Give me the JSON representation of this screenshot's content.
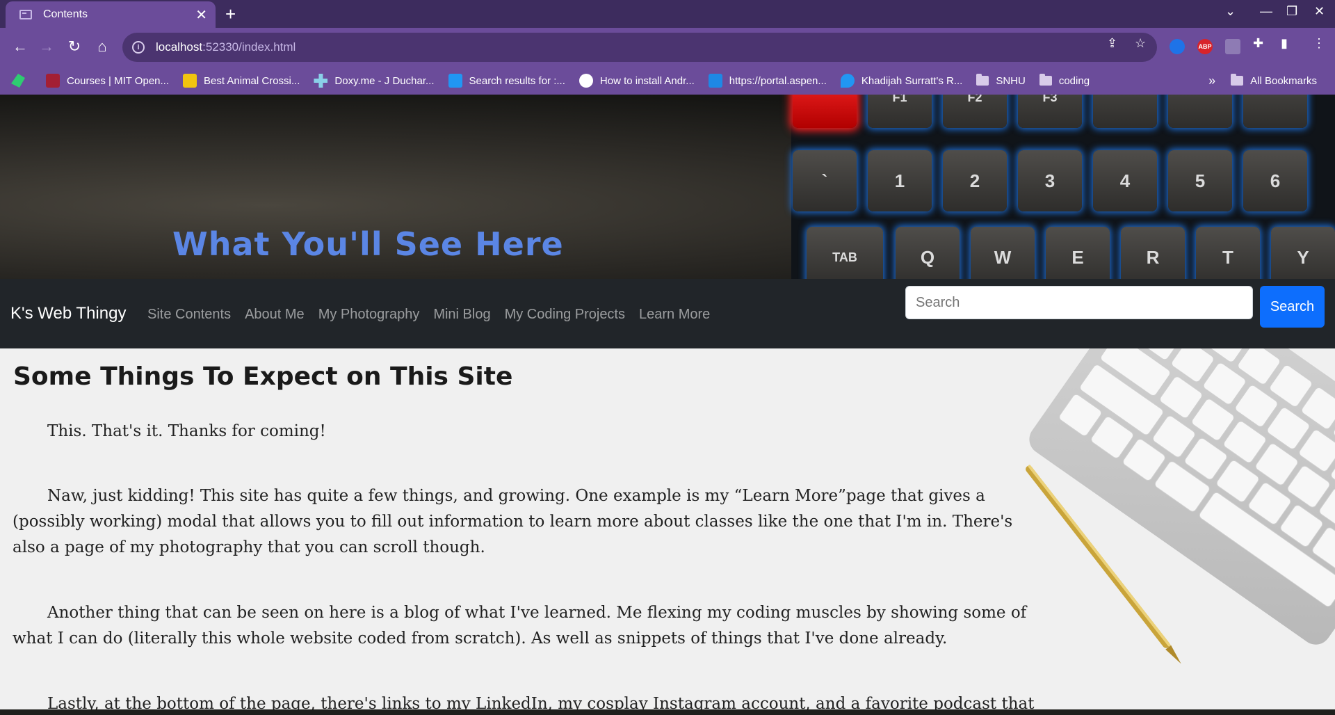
{
  "browser": {
    "tab_title": "Contents",
    "tab_close": "✕",
    "new_tab": "+",
    "url_host": "localhost",
    "url_path": ":52330/index.html",
    "back": "←",
    "forward": "→",
    "reload": "↻",
    "home": "⌂",
    "window_dropdown": "⌄",
    "minimize": "—",
    "maximize": "❐",
    "close": "✕",
    "share": "⇪",
    "star": "☆",
    "puzzle": "✚",
    "sidepanel": "▮",
    "menu": "⋮",
    "abp": "ABP"
  },
  "bookmarks": {
    "items": [
      {
        "label": "",
        "icon": "feather-icon",
        "color": "#2ecc71"
      },
      {
        "label": "Courses | MIT Open...",
        "icon": "mit-ocw-icon",
        "color": "#a31f34"
      },
      {
        "label": "Best Animal Crossi...",
        "icon": "im-icon",
        "color": "#f1c40f"
      },
      {
        "label": "Doxy.me - J Duchar...",
        "icon": "doxy-icon",
        "color": "#8ad0e8"
      },
      {
        "label": "Search results for :...",
        "icon": "phone-icon",
        "color": "#2196f3"
      },
      {
        "label": "How to install Andr...",
        "icon": "clock-icon",
        "color": "#ffffff"
      },
      {
        "label": "https://portal.aspen...",
        "icon": "aspen-icon",
        "color": "#1e88e5"
      },
      {
        "label": "Khadijah Surratt's R...",
        "icon": "flame-icon",
        "color": "#2196f3"
      },
      {
        "label": "SNHU",
        "icon": "folder-icon",
        "color": "#d8cbe9"
      },
      {
        "label": "coding",
        "icon": "folder-icon",
        "color": "#d8cbe9"
      }
    ],
    "overflow": "»",
    "all_bookmarks": "All Bookmarks"
  },
  "hero": {
    "title": "What You'll See Here",
    "keys": [
      "F1",
      "F2",
      "F3",
      "`",
      "1",
      "2",
      "3",
      "4",
      "5",
      "6",
      "TAB",
      "Q",
      "W",
      "E",
      "R",
      "T",
      "Y"
    ]
  },
  "nav": {
    "brand": "K's Web Thingy",
    "links": [
      "Site Contents",
      "About Me",
      "My Photography",
      "Mini Blog",
      "My Coding Projects",
      "Learn More"
    ],
    "search_placeholder": "Search",
    "search_button": "Search"
  },
  "main": {
    "heading": "Some Things To Expect on This Site",
    "paragraphs": [
      "This. That's it. Thanks for coming!",
      "Naw, just kidding! This site has quite a few things, and growing. One example is my “Learn More”page that gives a (possibly working) modal that allows you to fill out information to learn more about classes like the one that I'm in. There's also a page of my photography that you can scroll though.",
      "Another thing that can be seen on here is a blog of what I've learned. Me flexing my coding muscles by showing some of what I can do (literally this whole website coded from scratch). As well as snippets of things that I've done already.",
      "Lastly, at the bottom of the page, there's links to my LinkedIn, my cosplay Instagram account, and a favorite podcast that I listen to."
    ]
  },
  "colors": {
    "chrome_purple": "#6b4c9a",
    "tabstrip": "#3d2c5e",
    "navbar": "#212529",
    "accent_blue": "#0d6efd",
    "hero_title": "#5b86e5"
  }
}
